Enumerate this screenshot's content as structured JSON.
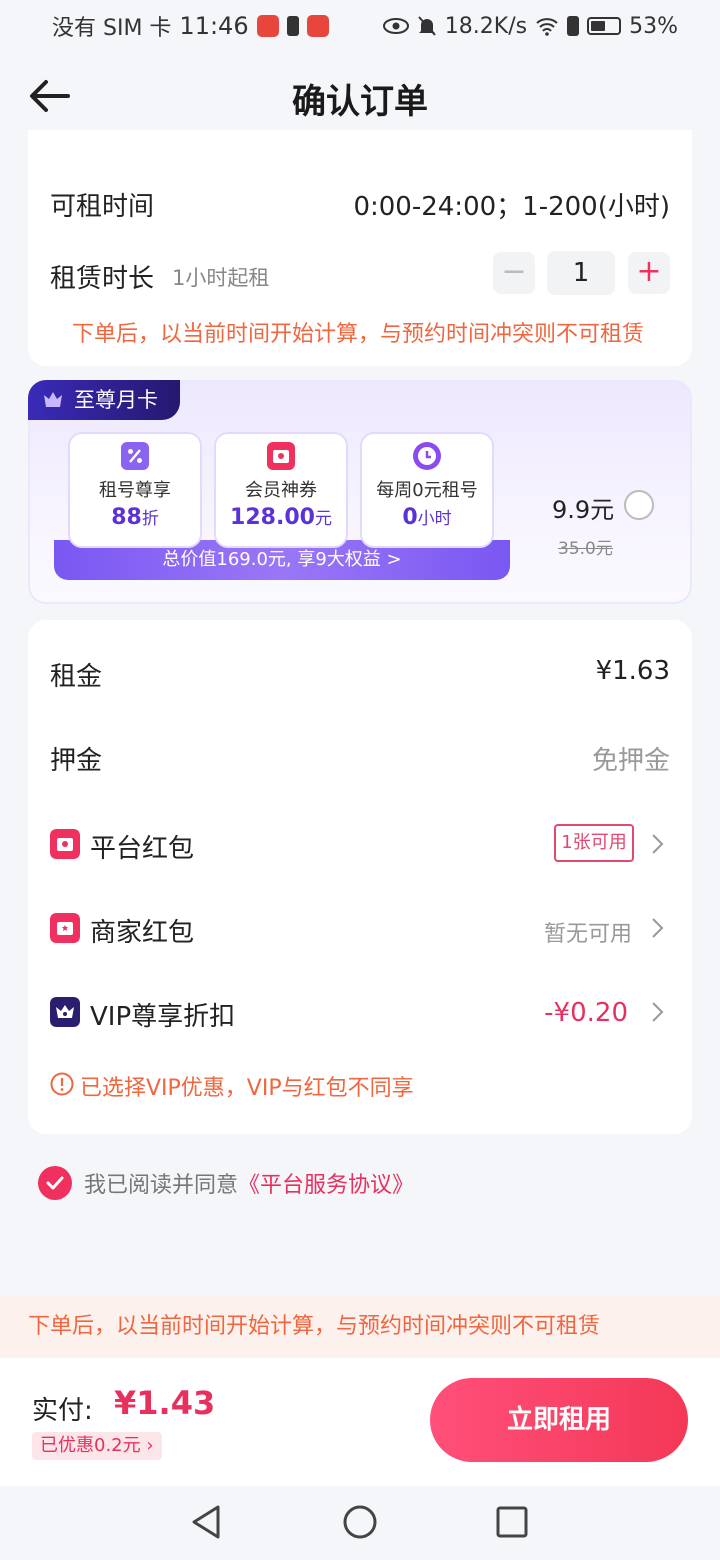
{
  "status_bar": {
    "carrier": "没有 SIM 卡",
    "time": "11:46",
    "network_speed": "18.2K/s",
    "battery": "53%"
  },
  "header": {
    "title": "确认订单",
    "back_icon": "arrow-left-icon"
  },
  "rental_info": {
    "available_time_label": "可租时间",
    "available_time_value": "0:00-24:00；1-200(小时)",
    "duration_label": "租赁时长",
    "duration_hint": "1小时起租",
    "minus_label": "−",
    "quantity": "1",
    "plus_label": "+",
    "warning": "下单后，以当前时间开始计算，与预约时间冲突则不可租赁"
  },
  "vip_card": {
    "tag": "至尊月卡",
    "benefits": [
      {
        "icon": "percent-icon",
        "title": "租号尊享",
        "value": "88",
        "unit": "折"
      },
      {
        "icon": "gift-icon",
        "title": "会员神券",
        "value": "128.00",
        "unit": "元"
      },
      {
        "icon": "clock-icon",
        "title": "每周0元租号",
        "value": "0",
        "unit": "小时"
      }
    ],
    "summary": "总价值169.0元, 享9大权益 >",
    "price": "9.9元",
    "original_price": "35.0元"
  },
  "fees": {
    "rent_label": "租金",
    "rent_value": "¥1.63",
    "deposit_label": "押金",
    "deposit_value": "免押金",
    "platform_coupon_label": "平台红包",
    "platform_coupon_value": "1张可用",
    "merchant_coupon_label": "商家红包",
    "merchant_coupon_value": "暂无可用",
    "vip_discount_label": "VIP尊享折扣",
    "vip_discount_value": "-¥0.20",
    "vip_notice": "已选择VIP优惠，VIP与红包不同享"
  },
  "agreement": {
    "text": "我已阅读并同意",
    "link": "《平台服务协议》"
  },
  "notice_bar": "下单后，以当前时间开始计算，与预约时间冲突则不可租赁",
  "footer": {
    "pay_label": "实付:",
    "pay_amount": "¥1.43",
    "saved": "已优惠0.2元",
    "rent_button": "立即租用"
  },
  "colors": {
    "accent": "#f0305e",
    "warning": "#f0663e",
    "vip_purple": "#5a32d6"
  }
}
